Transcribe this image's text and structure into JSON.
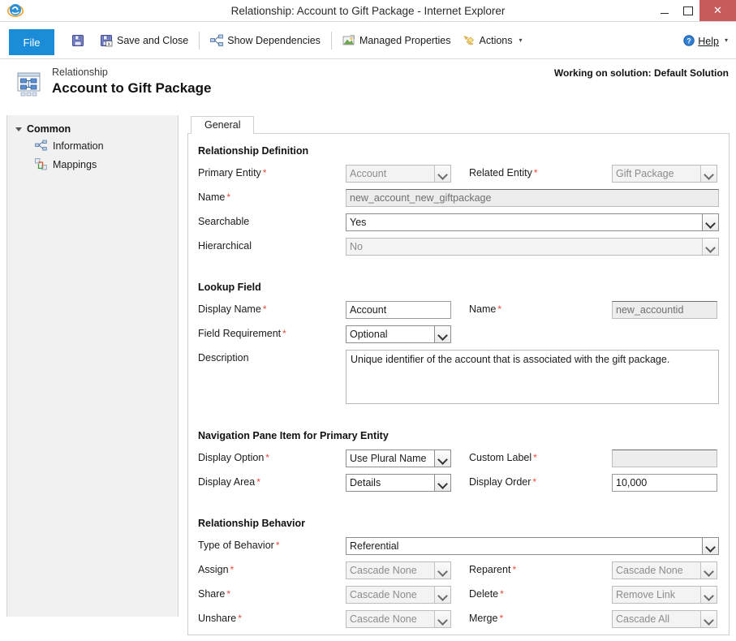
{
  "window": {
    "title": "Relationship: Account to Gift Package - Internet Explorer",
    "app_icon": "internet-explorer-icon",
    "minimize": "–",
    "maximize": "□",
    "close": "✕"
  },
  "ribbon": {
    "file_tab": "File",
    "items": [
      {
        "label": "",
        "icon": "save-icon"
      },
      {
        "label": "Save and Close",
        "icon": "save-and-close-icon"
      },
      {
        "label": "Show Dependencies",
        "icon": "dependencies-icon"
      },
      {
        "label": "Managed Properties",
        "icon": "managed-properties-icon"
      },
      {
        "label": "Actions",
        "icon": "actions-icon",
        "caret": "▾"
      }
    ],
    "help": {
      "label": "Help",
      "icon": "help-icon",
      "caret": "▾"
    }
  },
  "page_header": {
    "icon": "relationship-icon",
    "subtitle": "Relationship",
    "title": "Account to Gift Package",
    "solution_note": "Working on solution: Default Solution"
  },
  "sidebar": {
    "group_label": "Common",
    "items": [
      {
        "label": "Information",
        "icon": "information-icon"
      },
      {
        "label": "Mappings",
        "icon": "mappings-icon"
      }
    ]
  },
  "tabs": [
    {
      "label": "General",
      "selected": true
    }
  ],
  "form": {
    "sections": [
      {
        "title": "Relationship Definition",
        "fields": {
          "primary_entity": {
            "label": "Primary Entity",
            "required": "*",
            "value": "Account",
            "disabled": true
          },
          "related_entity": {
            "label": "Related Entity",
            "required": "*",
            "value": "Gift Package",
            "disabled": true
          },
          "name": {
            "label": "Name",
            "required": "*",
            "value": "new_account_new_giftpackage",
            "disabled": true
          },
          "searchable": {
            "label": "Searchable",
            "required": "",
            "value": "Yes",
            "disabled": false
          },
          "hierarchical": {
            "label": "Hierarchical",
            "required": "",
            "value": "No",
            "disabled": true
          }
        }
      },
      {
        "title": "Lookup Field",
        "fields": {
          "display_name": {
            "label": "Display Name",
            "required": "*",
            "value": "Account",
            "disabled": false
          },
          "lookup_name": {
            "label": "Name",
            "required": "*",
            "value": "new_accountid",
            "disabled": true
          },
          "field_requirement": {
            "label": "Field Requirement",
            "required": "*",
            "value": "Optional",
            "disabled": false
          },
          "description": {
            "label": "Description",
            "required": "",
            "value": "Unique identifier of the account that is associated with the gift package."
          }
        }
      },
      {
        "title": "Navigation Pane Item for Primary Entity",
        "fields": {
          "display_option": {
            "label": "Display Option",
            "required": "*",
            "value": "Use Plural Name",
            "disabled": false
          },
          "custom_label": {
            "label": "Custom Label",
            "required": "*",
            "value": "",
            "disabled": true
          },
          "display_area": {
            "label": "Display Area",
            "required": "*",
            "value": "Details",
            "disabled": false
          },
          "display_order": {
            "label": "Display Order",
            "required": "*",
            "value": "10,000",
            "disabled": false
          }
        }
      },
      {
        "title": "Relationship Behavior",
        "fields": {
          "type_of_behavior": {
            "label": "Type of Behavior",
            "required": "*",
            "value": "Referential",
            "disabled": false
          },
          "assign": {
            "label": "Assign",
            "required": "*",
            "value": "Cascade None",
            "disabled": true
          },
          "reparent": {
            "label": "Reparent",
            "required": "*",
            "value": "Cascade None",
            "disabled": true
          },
          "share": {
            "label": "Share",
            "required": "*",
            "value": "Cascade None",
            "disabled": true
          },
          "delete": {
            "label": "Delete",
            "required": "*",
            "value": "Remove Link",
            "disabled": true
          },
          "unshare": {
            "label": "Unshare",
            "required": "*",
            "value": "Cascade None",
            "disabled": true
          },
          "merge": {
            "label": "Merge",
            "required": "*",
            "value": "Cascade All",
            "disabled": true
          }
        }
      }
    ]
  },
  "colors": {
    "file_tab_blue": "#1a8cd8",
    "close_red": "#c75b5b",
    "required_red": "#e8483c",
    "sidebar_bg": "#f1f1f1"
  }
}
